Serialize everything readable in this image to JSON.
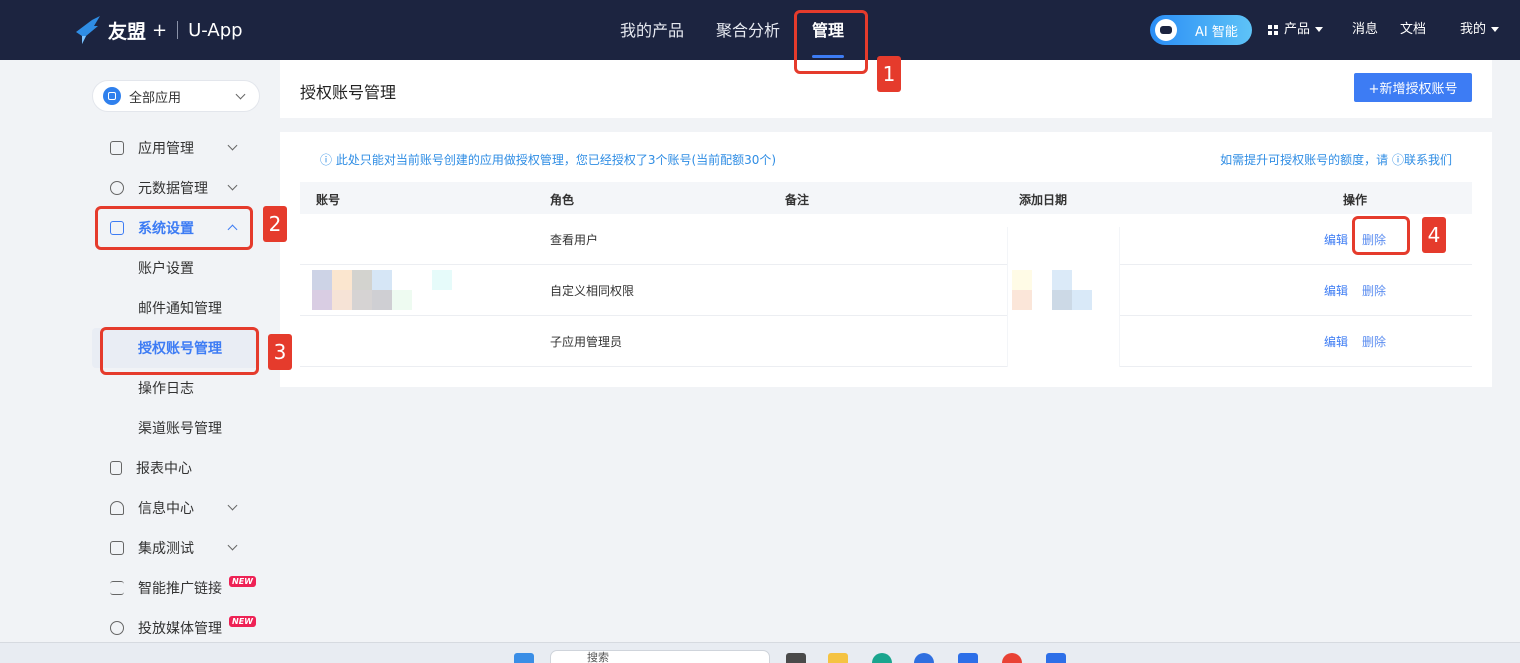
{
  "header": {
    "brand": "友盟",
    "brand_plus": "+",
    "product": "U-App",
    "nav": [
      "我的产品",
      "聚合分析",
      "管理"
    ],
    "ai_label": "AI 智能",
    "products": "产品",
    "messages": "消息",
    "docs": "文档",
    "mine": "我的"
  },
  "sidebar": {
    "app_select": "全部应用",
    "items": [
      {
        "label": "应用管理"
      },
      {
        "label": "元数据管理"
      },
      {
        "label": "系统设置"
      },
      {
        "label": "账户设置"
      },
      {
        "label": "邮件通知管理"
      },
      {
        "label": "授权账号管理"
      },
      {
        "label": "操作日志"
      },
      {
        "label": "渠道账号管理"
      },
      {
        "label": "报表中心"
      },
      {
        "label": "信息中心"
      },
      {
        "label": "集成测试"
      },
      {
        "label": "智能推广链接"
      },
      {
        "label": "投放媒体管理"
      }
    ],
    "new_badge": "NEW"
  },
  "page": {
    "title": "授权账号管理",
    "add_button": "+新增授权账号",
    "notice": "ⓘ  此处只能对当前账号创建的应用做授权管理，您已经授权了3个账号(当前配额30个)",
    "contact": "如需提升可授权账号的额度，请 ⓘ联系我们",
    "columns": [
      "账号",
      "角色",
      "备注",
      "添加日期",
      "操作"
    ],
    "rows": [
      {
        "role": "查看用户",
        "edit": "编辑",
        "delete": "删除"
      },
      {
        "role": "自定义相同权限",
        "edit": "编辑",
        "delete": "删除"
      },
      {
        "role": "子应用管理员",
        "edit": "编辑",
        "delete": "删除"
      }
    ]
  },
  "annotations": [
    "1",
    "2",
    "3",
    "4"
  ],
  "taskbar": {
    "search": "搜索"
  },
  "colors": {
    "header_bg": "#1c2440",
    "accent": "#3d7cf4",
    "annotation": "#e53b2c"
  }
}
